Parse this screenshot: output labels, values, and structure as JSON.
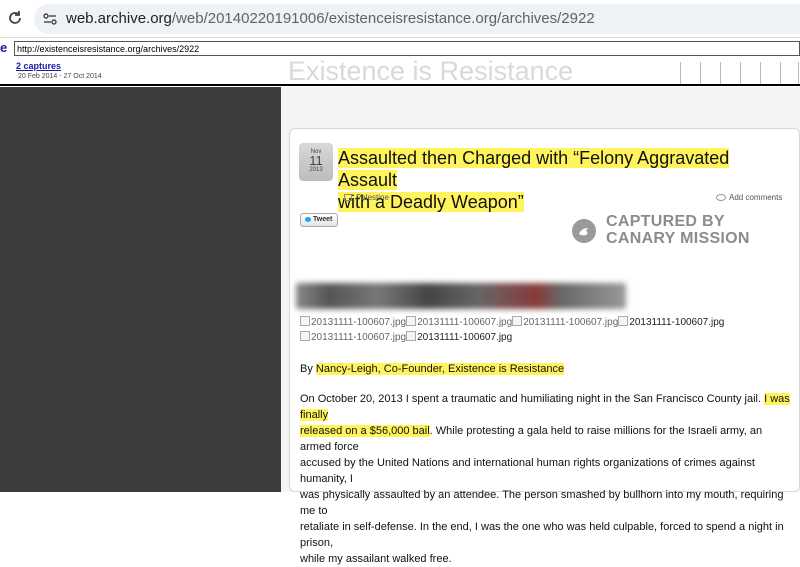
{
  "browser": {
    "url_host": "web.archive.org",
    "url_path": "/web/20140220191006/existenceisresistance.org/archives/2922"
  },
  "wayback": {
    "logo_edge": "e",
    "url_value": "http://existenceisresistance.org/archives/2922",
    "captures_label": "2 captures",
    "capture_dates": "20 Feb 2014 - 27 Oct 2014",
    "site_title": "Existence is Resistance"
  },
  "post": {
    "date_month": "Nov",
    "date_day": "11",
    "date_year": "2013",
    "title_line1": "Assaulted then Charged with “Felony Aggravated Assault",
    "title_line2": "with a Deadly Weapon”",
    "category": "Palestine",
    "comments_label": "Add comments",
    "tweet_label": "Tweet",
    "watermark_line1": "CAPTURED BY",
    "watermark_line2": "CANARY MISSION",
    "image_alt": "20131111-100607.jpg",
    "byline_prefix": "By ",
    "byline_author": "Nancy-Leigh, Co-Founder, Existence is Resistance",
    "para1": [
      "On October 20, 2013 I spent a traumatic and humiliating night in the San Francisco County jail. ",
      "I was finally",
      "released on a $56,000 bail",
      ". While protesting a gala held to raise millions for the Israeli army, an armed force",
      "accused by the United Nations and international human rights organizations of crimes against humanity, I",
      "was physically assaulted by an attendee. The person smashed by bullhorn into my mouth, requiring me to",
      "retaliate in self-defense. In the end, I was the one who was held culpable, forced to spend a night in prison,",
      "while my assailant walked free."
    ]
  }
}
